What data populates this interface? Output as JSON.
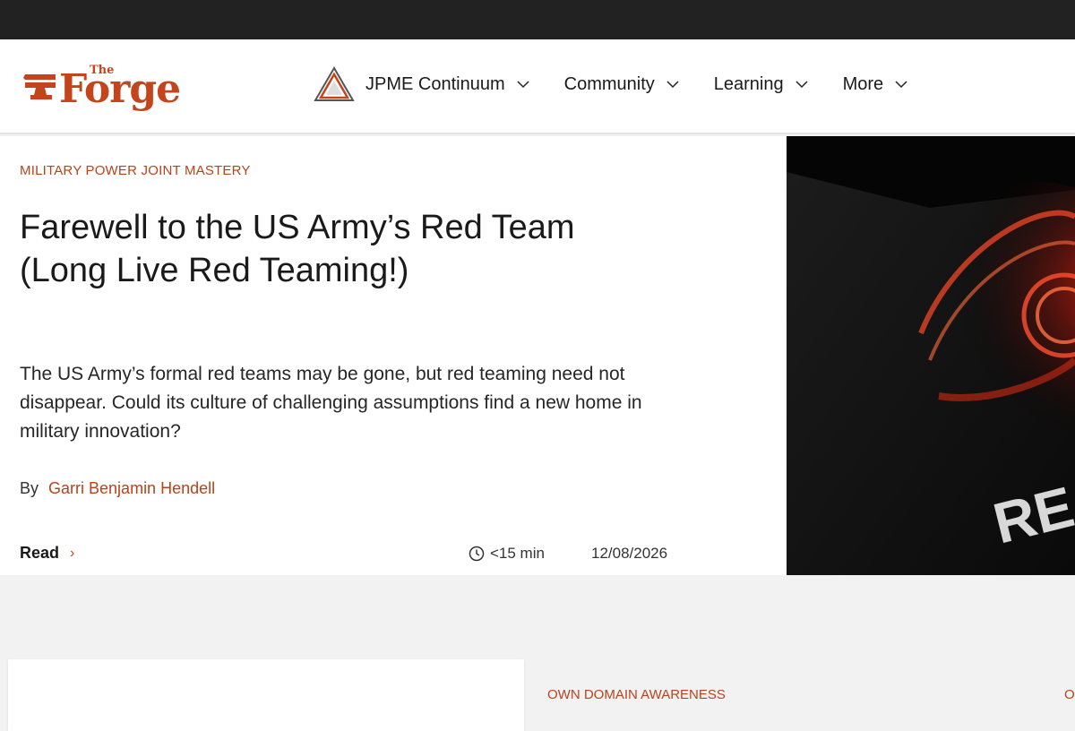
{
  "brand": {
    "logo_small": "The",
    "logo_text": "Forge",
    "accent": "#c4441c"
  },
  "nav": {
    "items": [
      {
        "label": "JPME Continuum",
        "icon": "triangle-logo-icon"
      },
      {
        "label": "Community"
      },
      {
        "label": "Learning"
      },
      {
        "label": "More"
      }
    ]
  },
  "hero": {
    "category": "MILITARY POWER JOINT MASTERY",
    "title_line1": "Farewell to the US Army’s Red Team",
    "title_line2": "(Long Live Red Teaming!)",
    "summary": "The US Army’s formal red teams may be gone, but red teaming need not disappear. Could its culture of challenging assumptions find a new home in military innovation?",
    "by_label": "By",
    "author": "Garri Benjamin Hendell",
    "read_label": "Read",
    "read_time": "<15 min",
    "date": "12/08/2026",
    "image_text": "RE"
  },
  "next": {
    "category_1": "OWN DOMAIN AWARENESS",
    "category_2": "O"
  }
}
